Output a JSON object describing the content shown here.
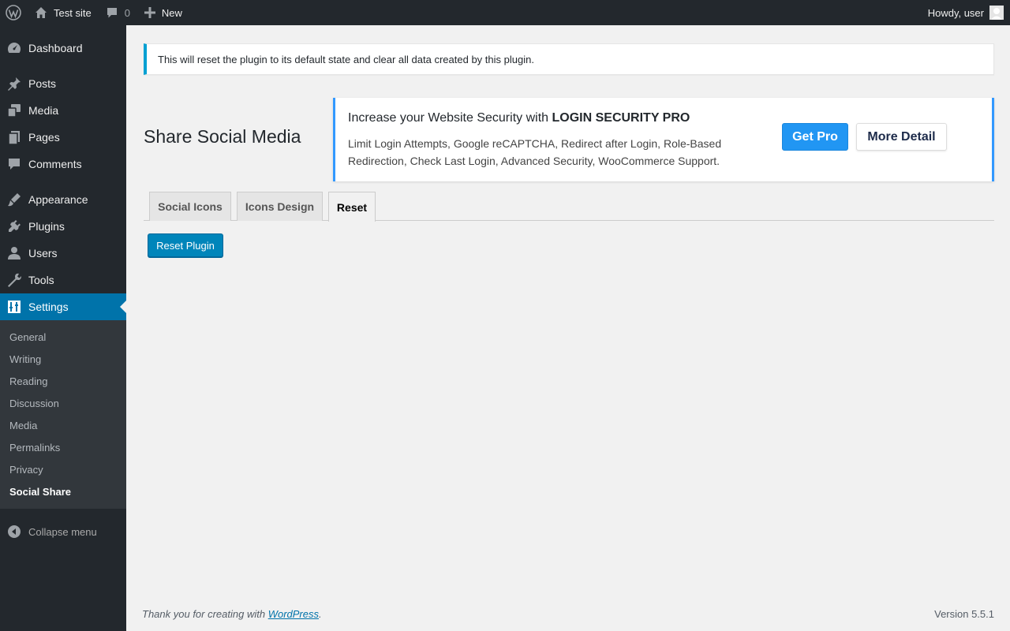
{
  "adminbar": {
    "site_name": "Test site",
    "comments_count": "0",
    "new_label": "New",
    "greeting": "Howdy, user"
  },
  "sidebar": {
    "items": [
      {
        "label": "Dashboard",
        "icon": "dashboard-icon"
      },
      {
        "label": "Posts",
        "icon": "pin-icon"
      },
      {
        "label": "Media",
        "icon": "media-icon"
      },
      {
        "label": "Pages",
        "icon": "pages-icon"
      },
      {
        "label": "Comments",
        "icon": "comment-icon"
      },
      {
        "label": "Appearance",
        "icon": "brush-icon"
      },
      {
        "label": "Plugins",
        "icon": "plug-icon"
      },
      {
        "label": "Users",
        "icon": "user-icon"
      },
      {
        "label": "Tools",
        "icon": "wrench-icon"
      },
      {
        "label": "Settings",
        "icon": "settings-icon"
      }
    ],
    "submenu": [
      "General",
      "Writing",
      "Reading",
      "Discussion",
      "Media",
      "Permalinks",
      "Privacy",
      "Social Share"
    ],
    "collapse_label": "Collapse menu"
  },
  "notice": {
    "text": "This will reset the plugin to its default state and clear all data created by this plugin."
  },
  "page": {
    "title": "Share Social Media"
  },
  "promo": {
    "head_prefix": "Increase your Website Security with ",
    "head_strong": "LOGIN SECURITY PRO",
    "description": "Limit Login Attempts, Google reCAPTCHA, Redirect after Login, Role-Based Redirection, Check Last Login, Advanced Security, WooCommerce Support.",
    "get_pro_label": "Get Pro",
    "more_detail_label": "More Detail"
  },
  "tabs": [
    {
      "label": "Social Icons",
      "active": false
    },
    {
      "label": "Icons Design",
      "active": false
    },
    {
      "label": "Reset",
      "active": true
    }
  ],
  "reset_button": "Reset Plugin",
  "footer": {
    "thanks_prefix": "Thank you for creating with ",
    "wp_link": "WordPress",
    "thanks_suffix": ".",
    "version": "Version 5.5.1"
  },
  "colors": {
    "adminbar_bg": "#23282d",
    "accent": "#0073aa",
    "notice_border": "#00a0d2",
    "promo_accent": "#3399ff",
    "pro_button": "#2196f3",
    "reset_button": "#0085ba"
  }
}
